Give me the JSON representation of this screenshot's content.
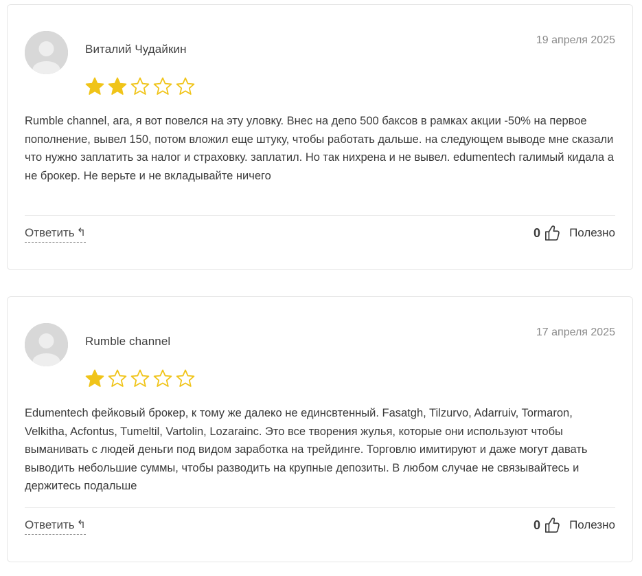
{
  "reviews": [
    {
      "author": "Виталий Чудайкин",
      "date": "19 апреля 2025",
      "rating": 2,
      "max_rating": 5,
      "star_color": "#f0c419",
      "text": "Rumble channel, ага, я вот повелся на эту уловку. Внес на депо 500 баксов в рамках акции -50% на первое пополнение, вывел 150, потом вложил еще штуку, чтобы работать дальше. на следующем выводе мне сказали что нужно заплатить за налог и страховку. заплатил. Но так нихрена и не вывел. edumentech галимый кидала а не брокер. Не верьте и не вкладывайте ничего",
      "reply_label": "Ответить",
      "reply_icon": "↰",
      "likes": "0",
      "helpful_label": "Полезно"
    },
    {
      "author": "Rumble channel",
      "date": "17 апреля 2025",
      "rating": 1,
      "max_rating": 5,
      "star_color": "#f0c419",
      "text": "Edumentech фейковый брокер, к тому же далеко не единсвтенный. Fasatgh, Tilzurvo, Adarruiv, Tormaron, Velkitha, Acfontus, Tumeltil, Vartolin, Lozarainc. Это все творения жулья, которые они используют чтобы выманивать с людей деньги под видом заработка на трейдинге. Торговлю имитируют и даже могут давать выводить небольшие суммы, чтобы разводить на крупные депозиты. В любом случае не связывайтесь и держитесь подальше",
      "reply_label": "Ответить",
      "reply_icon": "↰",
      "likes": "0",
      "helpful_label": "Полезно"
    }
  ]
}
